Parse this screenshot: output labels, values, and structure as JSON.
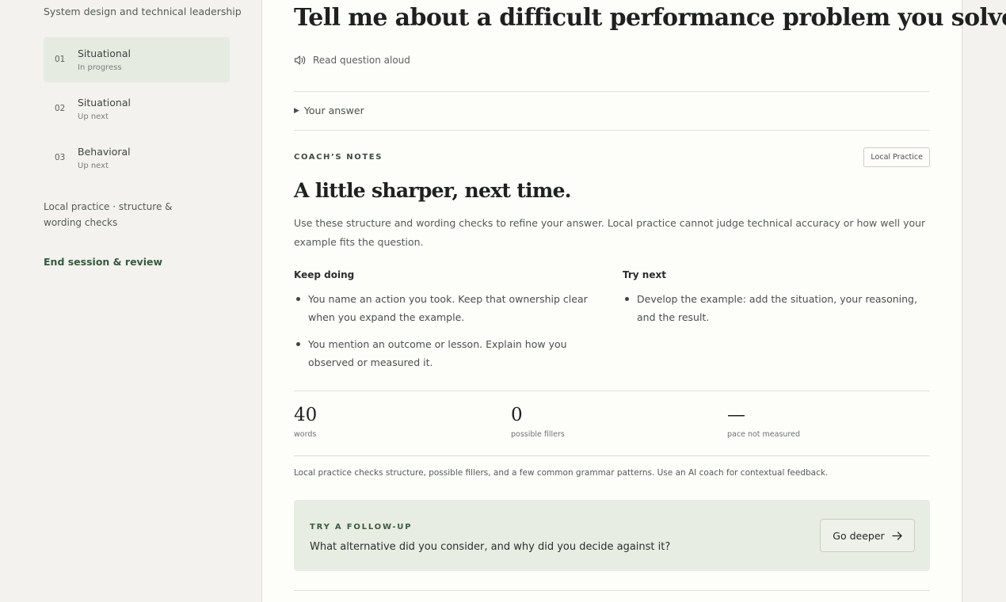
{
  "sidebar": {
    "context_line": "System design and technical leadership",
    "questions": [
      {
        "num": "01",
        "title": "Situational",
        "status": "In progress"
      },
      {
        "num": "02",
        "title": "Situational",
        "status": "Up next"
      },
      {
        "num": "03",
        "title": "Behavioral",
        "status": "Up next"
      }
    ],
    "mode_note": "Local practice · structure & wording checks",
    "end_session": "End session & review"
  },
  "question": {
    "text": "Tell me about a difficult performance problem you solved.",
    "read_aloud": "Read question aloud",
    "answer_toggle": "Your answer"
  },
  "coach": {
    "eyebrow": "COACH’S NOTES",
    "badge": "Local Practice",
    "heading": "A little sharper, next time.",
    "description": "Use these structure and wording checks to refine your answer. Local practice cannot judge technical accuracy or how well your example fits the question.",
    "keep_doing": {
      "title": "Keep doing",
      "items": [
        "You name an action you took. Keep that ownership clear when you expand the example.",
        "You mention an outcome or lesson. Explain how you observed or measured it."
      ]
    },
    "try_next": {
      "title": "Try next",
      "items": [
        "Develop the example: add the situation, your reasoning, and the result."
      ]
    }
  },
  "stats": [
    {
      "value": "40",
      "label": "words"
    },
    {
      "value": "0",
      "label": "possible fillers"
    },
    {
      "value": "—",
      "label": "pace not measured"
    }
  ],
  "footnote": "Local practice checks structure, possible fillers, and a few common grammar patterns. Use an AI coach for contextual feedback.",
  "followup": {
    "eyebrow": "TRY A FOLLOW-UP",
    "question": "What alternative did you consider, and why did you decide against it?",
    "button": "Go deeper"
  },
  "colors": {
    "accent": "#355a3d",
    "active_bg": "#e6ebe1",
    "followup_bg": "#e8ede3",
    "panel_bg": "#fdfdfa",
    "page_bg": "#f3f2ee"
  }
}
